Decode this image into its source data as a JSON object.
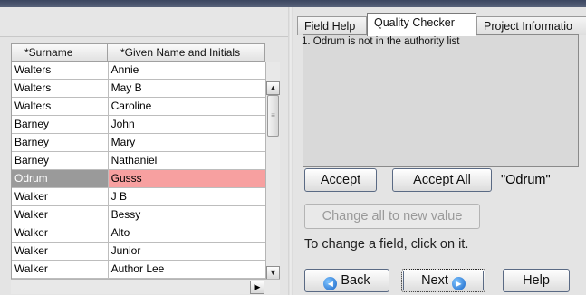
{
  "table": {
    "columns": [
      "*Surname",
      "*Given Name and Initials"
    ],
    "rows": [
      {
        "surname": "Walters",
        "given": "Annie"
      },
      {
        "surname": "Walters",
        "given": "May B"
      },
      {
        "surname": "Walters",
        "given": "Caroline"
      },
      {
        "surname": "Barney",
        "given": "John"
      },
      {
        "surname": "Barney",
        "given": "Mary"
      },
      {
        "surname": "Barney",
        "given": "Nathaniel"
      },
      {
        "surname": "Odrum",
        "given": "Gusss"
      },
      {
        "surname": "Walker",
        "given": "J B"
      },
      {
        "surname": "Walker",
        "given": "Bessy"
      },
      {
        "surname": "Walker",
        "given": "Alto"
      },
      {
        "surname": "Walker",
        "given": "Junior"
      },
      {
        "surname": "Walker",
        "given": "Author Lee"
      }
    ],
    "selected_row": 6,
    "highlight_color": "#f7a0a0"
  },
  "tabs": {
    "field_help": "Field Help",
    "quality_checker": "Quality Checker",
    "project_information": "Project Informatio",
    "active": "Quality Checker"
  },
  "checker": {
    "message": "1. Odrum is not in the authority list",
    "accept_label": "Accept",
    "accept_all_label": "Accept All",
    "current_value": "\"Odrum\"",
    "change_all_label": "Change all to new value",
    "hint": "To change a field, click on it."
  },
  "nav": {
    "back_label": "Back",
    "next_label": "Next",
    "help_label": "Help"
  },
  "icons": {
    "back": "left-arrow-circle-icon",
    "next": "right-arrow-circle-icon",
    "scroll_up": "chevron-up-icon",
    "scroll_down": "chevron-down-icon",
    "scroll_right": "chevron-right-icon"
  }
}
